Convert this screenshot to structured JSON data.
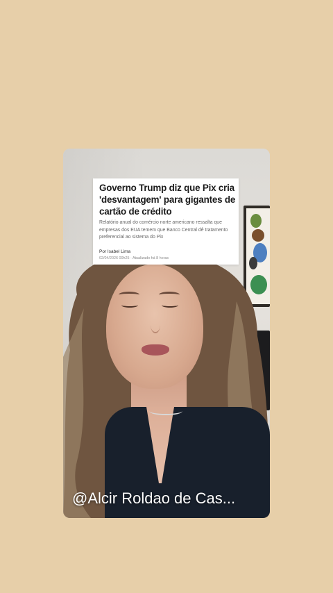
{
  "article": {
    "title": "Governo Trump diz que Pix cria 'desvantagem' para gigantes de cartão de crédito",
    "subtitle": "Relatório anual do comércio norte americano ressalta que empresas dos EUA temem que Banco Central dê tratamento preferencial ao sistema do Pix",
    "author": "Por Isabel Lima",
    "date_line": "02/04/2026 00h25 · Atualizado há 8 horas"
  },
  "caption": {
    "text": "@Alcir Roldao de Cas..."
  },
  "colors": {
    "page_background": "#e7cfa9",
    "card_background": "#ffffff",
    "caption_text": "#ffffff",
    "title_text": "#1b1b1b"
  }
}
